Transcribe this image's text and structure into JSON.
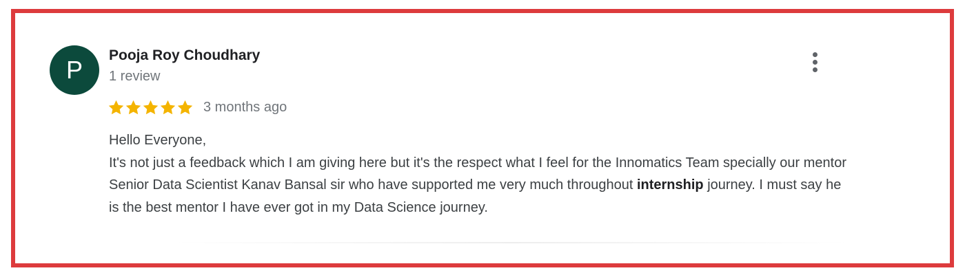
{
  "review": {
    "avatar_letter": "P",
    "avatar_color": "#0c4a3c",
    "reviewer_name": "Pooja Roy Choudhary",
    "review_count": "1 review",
    "rating": 5,
    "rating_max": 5,
    "star_color": "#f4b400",
    "time_ago": "3 months ago",
    "body": {
      "greeting": "Hello Everyone,",
      "text_before_bold": "It's not just a feedback which I am giving here but it's the respect what I feel for the Innomatics Team specially our mentor Senior Data Scientist Kanav Bansal sir who have supported me very much throughout ",
      "bold_word": "internship",
      "text_after_bold": " journey. I must say he is the best mentor I have ever got in my Data Science journey."
    },
    "menu_icon": "more-vertical-icon"
  },
  "frame_border_color": "#dd3b3d"
}
